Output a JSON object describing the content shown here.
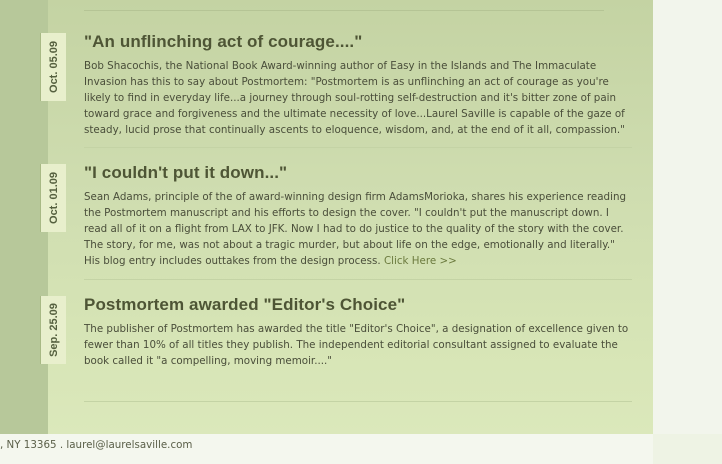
{
  "news": [
    {
      "date": "Oct. 05.09",
      "title": "\"An unflinching act of courage....\"",
      "body": "Bob Shacochis, the National Book Award-winning author of Easy in the Islands and The Immaculate Invasion has this to say about Postmortem: \"Postmortem is as unflinching an act of courage as you're likely to find in everyday life...a journey through soul-rotting self-destruction and it's bitter zone of pain toward grace and forgiveness and the ultimate necessity of love...Laurel Saville is capable of the gaze of steady, lucid prose that continually ascents to eloquence, wisdom, and, at the end of it all, compassion.\"",
      "link": ""
    },
    {
      "date": "Oct. 01.09",
      "title": "\"I couldn't put it down...\"",
      "body": "Sean Adams, principle of the of award-winning design firm AdamsMorioka, shares his experience reading the Postmortem manuscript and his efforts to design the cover. \"I couldn't put the manuscript down. I read all of it on a flight from LAX to JFK. Now I had to do justice to the quality of the story with the cover. The story, for me, was not about a tragic murder, but about life on the edge, emotionally and literally.\" His blog entry includes outtakes from the design process.",
      "link": "Click Here >>"
    },
    {
      "date": "Sep. 25.09",
      "title": "Postmortem awarded \"Editor's Choice\"",
      "body": "The publisher of Postmortem has awarded the title \"Editor's Choice\", a designation of excellence given to fewer than 10% of all titles they publish. The independent editorial consultant assigned to evaluate the book called it \"a compelling, moving memoir....\"",
      "link": ""
    }
  ],
  "footer": {
    "address": ", NY 13365 . ",
    "email": "laurel@laurelsaville.com"
  }
}
